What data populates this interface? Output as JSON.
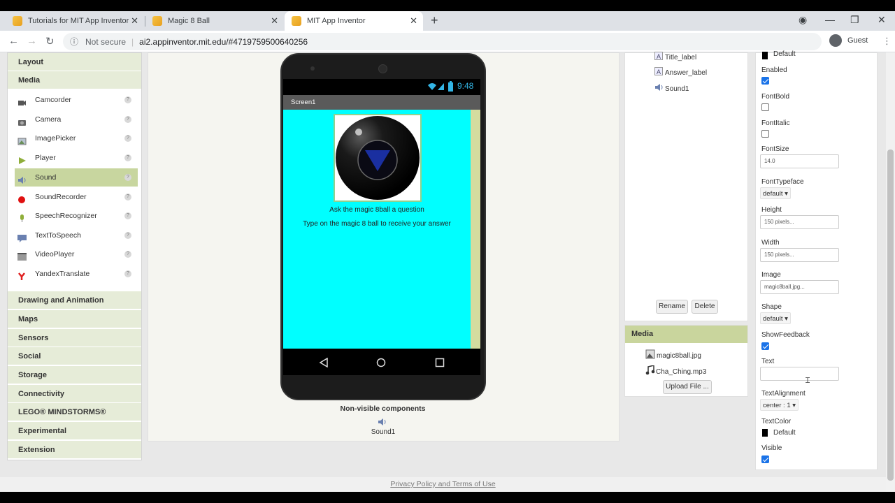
{
  "browser": {
    "tabs": [
      {
        "title": "Tutorials for MIT App Inventor",
        "active": false
      },
      {
        "title": "Magic 8 Ball",
        "active": false
      },
      {
        "title": "MIT App Inventor",
        "active": true
      }
    ],
    "new_tab": "+",
    "security": "Not secure",
    "url": "ai2.appinventor.mit.edu/#4719759500640256",
    "profile": "Guest"
  },
  "palette": {
    "sections_top": [
      "Layout",
      "Media"
    ],
    "media_items": [
      {
        "label": "Camcorder",
        "icon": "camcorder-icon"
      },
      {
        "label": "Camera",
        "icon": "camera-icon"
      },
      {
        "label": "ImagePicker",
        "icon": "image-picker-icon"
      },
      {
        "label": "Player",
        "icon": "player-icon"
      },
      {
        "label": "Sound",
        "icon": "sound-icon",
        "selected": true
      },
      {
        "label": "SoundRecorder",
        "icon": "sound-recorder-icon"
      },
      {
        "label": "SpeechRecognizer",
        "icon": "speech-recognizer-icon"
      },
      {
        "label": "TextToSpeech",
        "icon": "text-to-speech-icon"
      },
      {
        "label": "VideoPlayer",
        "icon": "video-player-icon"
      },
      {
        "label": "YandexTranslate",
        "icon": "yandex-translate-icon"
      }
    ],
    "sections_bottom": [
      "Drawing and Animation",
      "Maps",
      "Sensors",
      "Social",
      "Storage",
      "Connectivity",
      "LEGO® MINDSTORMS®",
      "Experimental",
      "Extension"
    ]
  },
  "viewer": {
    "status_time": "9:48",
    "screen_title": "Screen1",
    "title_label": "Ask the magic 8ball a question",
    "answer_label": "Type on the magic 8 ball to receive your answer",
    "screen_color": "#00ffff",
    "nonvisible_title": "Non-visible components",
    "nonvisible_item": "Sound1"
  },
  "components": {
    "items": [
      "Title_label",
      "Answer_label",
      "Sound1"
    ],
    "rename": "Rename",
    "delete": "Delete"
  },
  "media": {
    "title": "Media",
    "files": [
      "magic8ball.jpg",
      "Cha_Ching.mp3"
    ],
    "upload": "Upload File ..."
  },
  "properties": {
    "bg_default": "Default",
    "enabled_label": "Enabled",
    "enabled": true,
    "fontbold_label": "FontBold",
    "fontbold": false,
    "fontitalic_label": "FontItalic",
    "fontitalic": false,
    "fontsize_label": "FontSize",
    "fontsize": "14.0",
    "fonttypeface_label": "FontTypeface",
    "fonttypeface": "default ▾",
    "height_label": "Height",
    "height": "150 pixels...",
    "width_label": "Width",
    "width": "150 pixels...",
    "image_label": "Image",
    "image": "magic8ball.jpg...",
    "shape_label": "Shape",
    "shape": "default ▾",
    "showfeedback_label": "ShowFeedback",
    "showfeedback": true,
    "text_label": "Text",
    "text": "",
    "textalignment_label": "TextAlignment",
    "textalignment": "center : 1 ▾",
    "textcolor_label": "TextColor",
    "textcolor": "Default",
    "visible_label": "Visible",
    "visible": true
  },
  "footer": "Privacy Policy and Terms of Use"
}
